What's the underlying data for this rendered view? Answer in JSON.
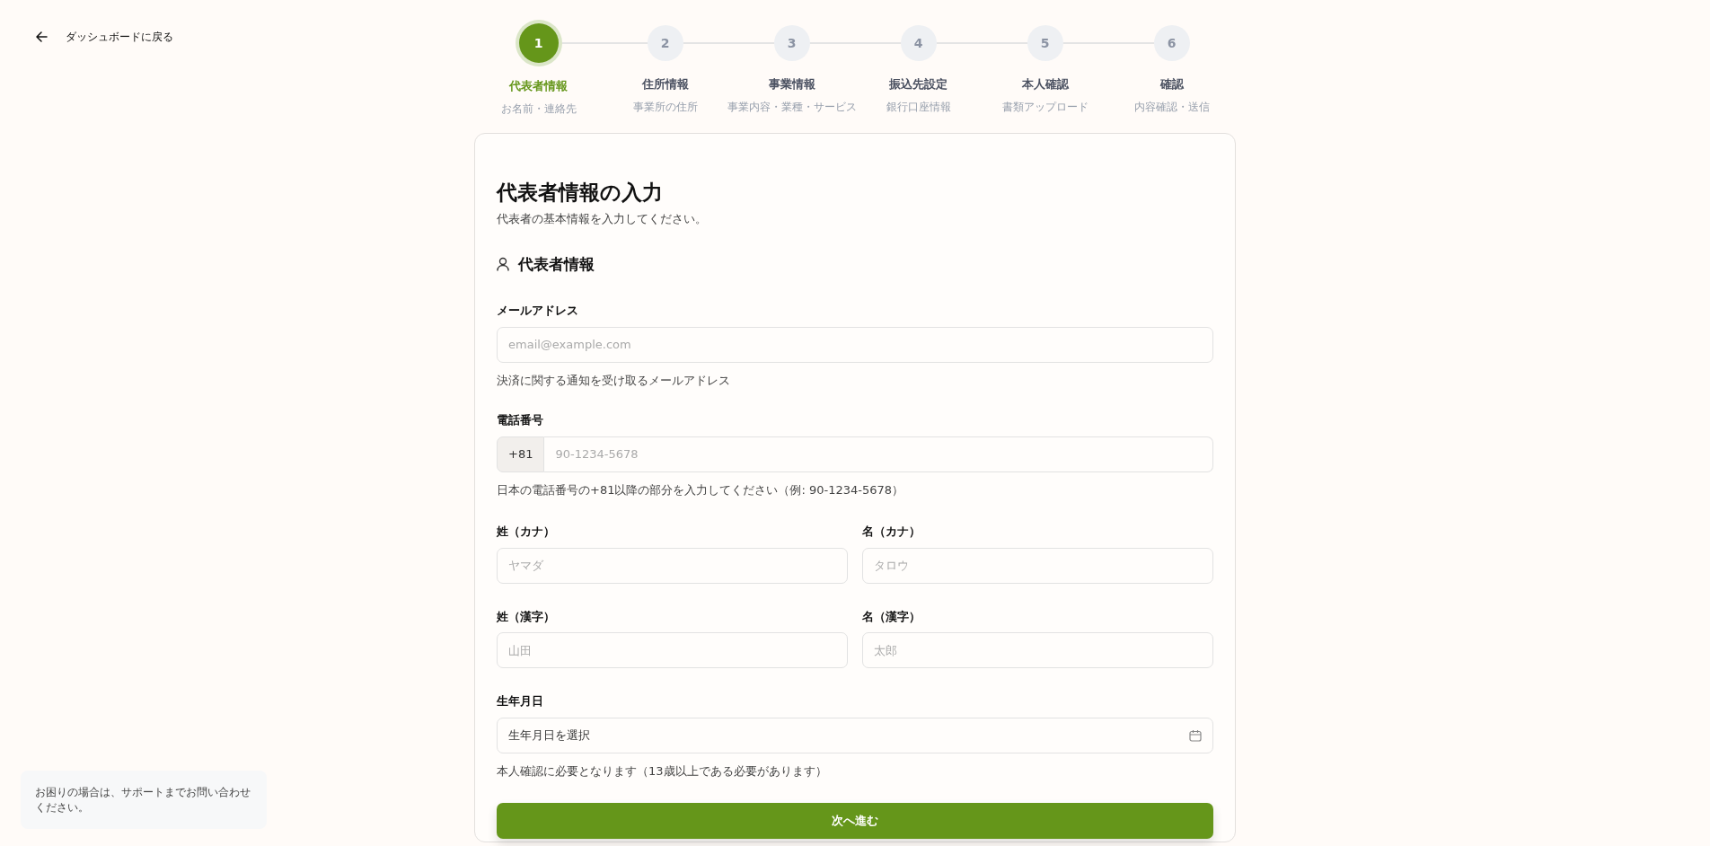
{
  "back_link": {
    "label": "ダッシュボードに戻る"
  },
  "steps": [
    {
      "number": "1",
      "title": "代表者情報",
      "subtitle": "お名前・連絡先",
      "selected": true
    },
    {
      "number": "2",
      "title": "住所情報",
      "subtitle": "事業所の住所",
      "selected": false
    },
    {
      "number": "3",
      "title": "事業情報",
      "subtitle": "事業内容・業種・サービス",
      "selected": false
    },
    {
      "number": "4",
      "title": "振込先設定",
      "subtitle": "銀行口座情報",
      "selected": false
    },
    {
      "number": "5",
      "title": "本人確認",
      "subtitle": "書類アップロード",
      "selected": false
    },
    {
      "number": "6",
      "title": "確認",
      "subtitle": "内容確認・送信",
      "selected": false
    }
  ],
  "form": {
    "title": "代表者情報の入力",
    "description": "代表者の基本情報を入力してください。",
    "section_title": "代表者情報",
    "fields": [
      {
        "kind": "text",
        "label": "メールアドレス",
        "placeholder": "email@example.com",
        "help": "決済に関する通知を受け取るメールアドレス"
      },
      {
        "kind": "phone",
        "label": "電話番号",
        "prefix": "+81",
        "placeholder": "90-1234-5678",
        "help": "日本の電話番号の+81以降の部分を入力してください（例: 90-1234-5678）"
      },
      {
        "kind": "pair",
        "items": [
          {
            "label": "姓（カナ）",
            "placeholder": "ヤマダ"
          },
          {
            "label": "名（カナ）",
            "placeholder": "タロウ"
          }
        ]
      },
      {
        "kind": "pair",
        "items": [
          {
            "label": "姓（漢字）",
            "placeholder": "山田"
          },
          {
            "label": "名（漢字）",
            "placeholder": "太郎"
          }
        ]
      },
      {
        "kind": "date",
        "label": "生年月日",
        "value": "生年月日を選択",
        "help": "本人確認に必要となります（13歳以上である必要があります）"
      }
    ],
    "submit": "次へ進む"
  },
  "help_box": {
    "text": "お困りの場合は、サポートまでお問い合わせください。"
  }
}
